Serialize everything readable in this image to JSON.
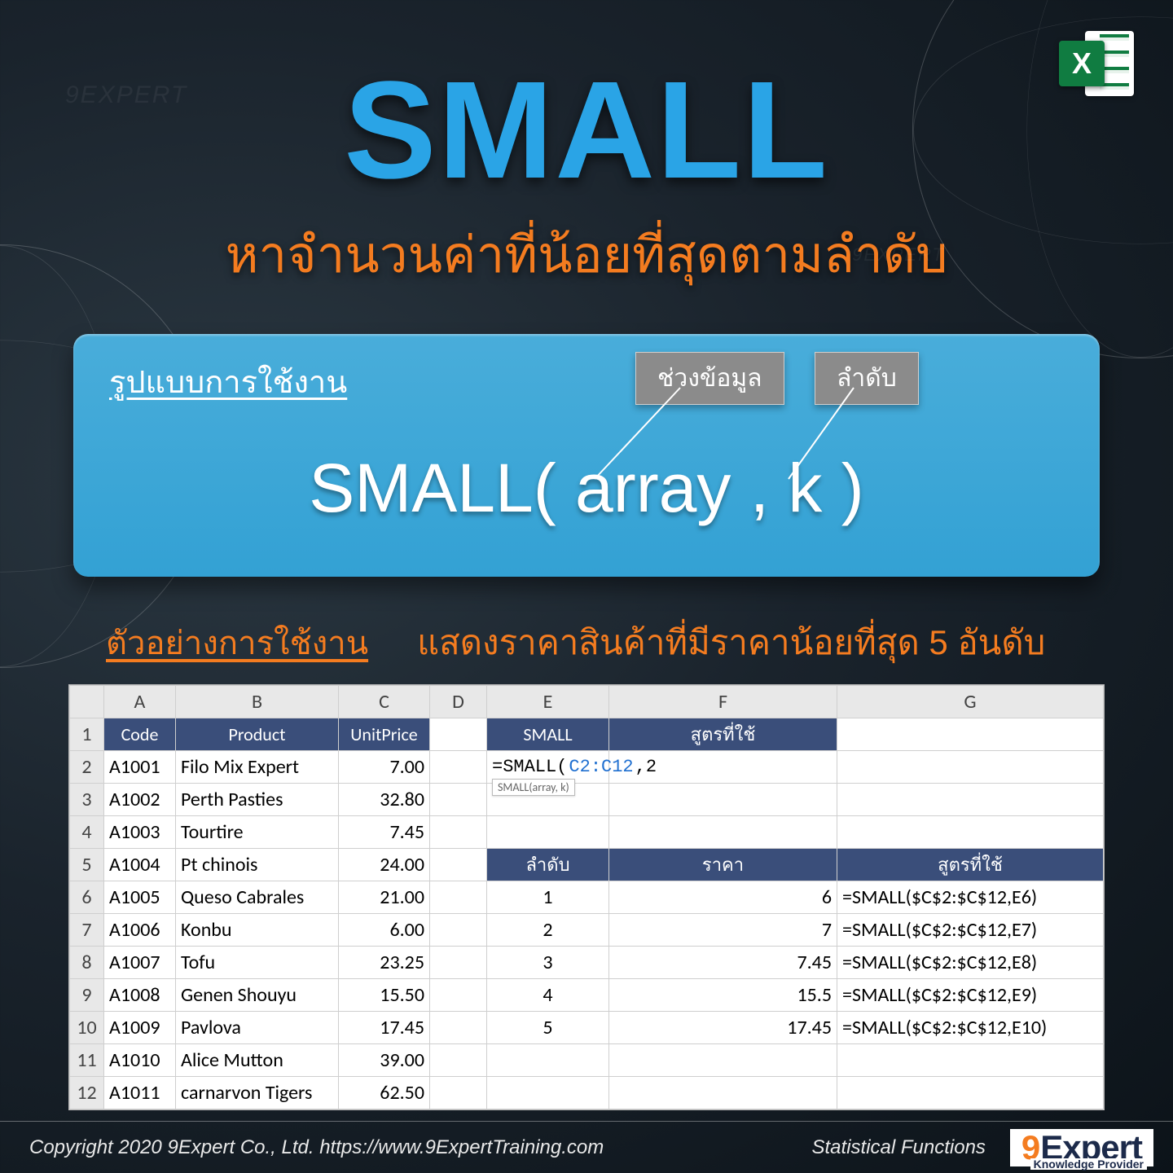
{
  "watermark": "9EXPERT",
  "title": "SMALL",
  "subtitle": "หาจำนวนค่าที่น้อยที่สุดตามลำดับ",
  "panel": {
    "usage_label": "รูปแบบการใช้งาน",
    "tag_array": "ช่วงข้อมูล",
    "tag_k": "ลำดับ",
    "formula": "SMALL( array , k )"
  },
  "example": {
    "label": "ตัวอย่างการใช้งาน",
    "desc": "แสดงราคาสินค้าที่มีราคาน้อยที่สุด 5 อันดับ"
  },
  "sheet": {
    "columns": [
      "A",
      "B",
      "C",
      "D",
      "E",
      "F",
      "G"
    ],
    "product_headers": {
      "code": "Code",
      "product": "Product",
      "unitprice": "UnitPrice"
    },
    "products": [
      {
        "code": "A1001",
        "name": "Filo Mix Expert",
        "price": "7.00"
      },
      {
        "code": "A1002",
        "name": "Perth Pasties",
        "price": "32.80"
      },
      {
        "code": "A1003",
        "name": "Tourtire",
        "price": "7.45"
      },
      {
        "code": "A1004",
        "name": "Pt chinois",
        "price": "24.00"
      },
      {
        "code": "A1005",
        "name": "Queso Cabrales",
        "price": "21.00"
      },
      {
        "code": "A1006",
        "name": "Konbu",
        "price": "6.00"
      },
      {
        "code": "A1007",
        "name": "Tofu",
        "price": "23.25"
      },
      {
        "code": "A1008",
        "name": "Genen Shouyu",
        "price": "15.50"
      },
      {
        "code": "A1009",
        "name": "Pavlova",
        "price": "17.45"
      },
      {
        "code": "A1010",
        "name": "Alice Mutton",
        "price": "39.00"
      },
      {
        "code": "A1011",
        "name": "carnarvon Tigers",
        "price": "62.50"
      }
    ],
    "top_block": {
      "h_small": "SMALL",
      "h_formula": "สูตรที่ใช้",
      "entry_prefix": "=SMALL(",
      "entry_ref": "C2:C12",
      "entry_suffix": ",2",
      "hint": "SMALL(array, k)"
    },
    "result_headers": {
      "rank": "ลำดับ",
      "price": "ราคา",
      "formula": "สูตรที่ใช้"
    },
    "results": [
      {
        "rank": "1",
        "price": "6",
        "formula": "=SMALL($C$2:$C$12,E6)"
      },
      {
        "rank": "2",
        "price": "7",
        "formula": "=SMALL($C$2:$C$12,E7)"
      },
      {
        "rank": "3",
        "price": "7.45",
        "formula": "=SMALL($C$2:$C$12,E8)"
      },
      {
        "rank": "4",
        "price": "15.5",
        "formula": "=SMALL($C$2:$C$12,E9)"
      },
      {
        "rank": "5",
        "price": "17.45",
        "formula": "=SMALL($C$2:$C$12,E10)"
      }
    ]
  },
  "footer": {
    "copyright": "Copyright 2020 9Expert Co., Ltd.   https://www.9ExpertTraining.com",
    "category": "Statistical Functions",
    "brand_nine": "9",
    "brand_exp": "Expert",
    "brand_sub": "Knowledge Provider"
  },
  "excel_badge": "X"
}
